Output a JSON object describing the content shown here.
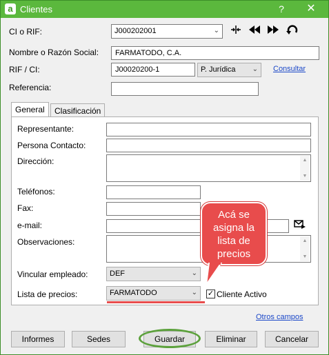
{
  "window": {
    "title": "Clientes",
    "help": "?",
    "close": "✕",
    "app_icon": "a"
  },
  "fields": {
    "ci_rif": {
      "label": "CI o RIF:",
      "value": "J000202001"
    },
    "nombre": {
      "label": "Nombre o Razón Social:",
      "value": "FARMATODO, C.A."
    },
    "rif_ci": {
      "label": "RIF / CI:",
      "value": "J00020200-1"
    },
    "tipo_persona": {
      "value": "P. Jurídica"
    },
    "referencia": {
      "label": "Referencia:",
      "value": ""
    }
  },
  "links": {
    "consultar": "Consultar",
    "otros_campos": "Otros campos"
  },
  "toolbar": {
    "split_icon": "split-icon",
    "prev_icon": "rewind-icon",
    "next_icon": "fast-forward-icon",
    "undo_icon": "undo-icon"
  },
  "tabs": [
    {
      "label": "General",
      "active": true
    },
    {
      "label": "Clasificación",
      "active": false
    }
  ],
  "general": {
    "representante": "Representante:",
    "persona_contacto": "Persona Contacto:",
    "direccion": "Dirección:",
    "telefonos": "Teléfonos:",
    "fax": "Fax:",
    "email": "e-mail:",
    "observaciones": "Observaciones:",
    "vincular_empleado": {
      "label": "Vincular empleado:",
      "value": "DEF"
    },
    "lista_precios": {
      "label": "Lista de precios:",
      "value": "FARMATODO"
    },
    "cliente_activo": {
      "label": "Cliente Activo",
      "checked": true
    }
  },
  "annotation": {
    "callout_text": [
      "Acá se",
      "asigna la",
      "lista de",
      "precios"
    ],
    "callout_color": "#e84c4c",
    "highlight_color": "#5ca13c"
  },
  "buttons": {
    "informes": "Informes",
    "sedes": "Sedes",
    "guardar": "Guardar",
    "eliminar": "Eliminar",
    "cancelar": "Cancelar"
  }
}
